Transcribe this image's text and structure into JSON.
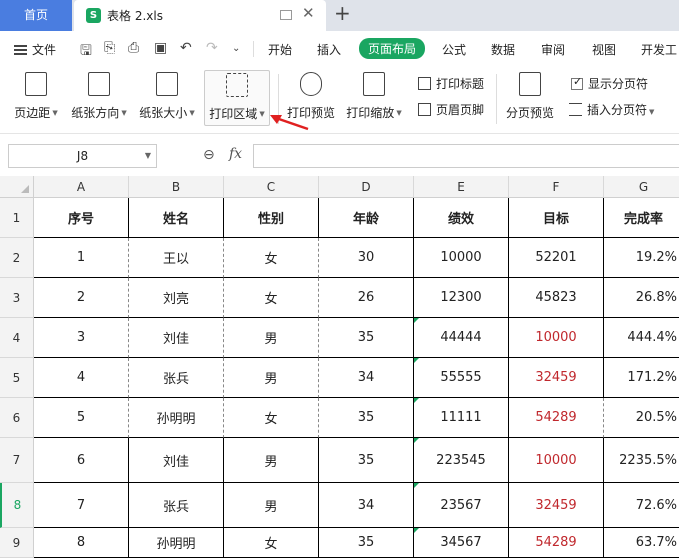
{
  "tabs": {
    "home": "首页",
    "file_icon": "S",
    "file_name": "表格 2.xls",
    "add": "+"
  },
  "menu": {
    "file_label": "文件",
    "tabs": [
      "开始",
      "插入",
      "页面布局",
      "公式",
      "数据",
      "审阅",
      "视图",
      "开发工"
    ],
    "active_index": 2
  },
  "ribbon": {
    "buttons": [
      {
        "label": "页边距",
        "icon": "margins-icon",
        "dropdown": true
      },
      {
        "label": "纸张方向",
        "icon": "orientation-icon",
        "dropdown": true
      },
      {
        "label": "纸张大小",
        "icon": "paper-size-icon",
        "dropdown": true
      },
      {
        "label": "打印区域",
        "icon": "print-area-icon",
        "dropdown": true
      },
      {
        "label": "打印预览",
        "icon": "print-preview-icon",
        "dropdown": false
      },
      {
        "label": "打印缩放",
        "icon": "print-scale-icon",
        "dropdown": true
      },
      {
        "label": "分页预览",
        "icon": "page-break-preview-icon",
        "dropdown": false
      }
    ],
    "print_titles": "打印标题",
    "header_footer": "页眉页脚",
    "show_page_breaks": "显示分页符",
    "insert_page_break": "插入分页符"
  },
  "formula_bar": {
    "cell_ref": "J8",
    "fx": "fx",
    "value": ""
  },
  "grid": {
    "columns": [
      "A",
      "B",
      "C",
      "D",
      "E",
      "F",
      "G"
    ],
    "row_numbers": [
      "1",
      "2",
      "3",
      "4",
      "5",
      "6",
      "7",
      "8",
      "9"
    ],
    "current_row": "8",
    "header": [
      "序号",
      "姓名",
      "性别",
      "年龄",
      "绩效",
      "目标",
      "完成率"
    ],
    "rows": [
      [
        "1",
        "王以",
        "女",
        "30",
        "10000",
        "52201",
        "19.2%"
      ],
      [
        "2",
        "刘亮",
        "女",
        "26",
        "12300",
        "45823",
        "26.8%"
      ],
      [
        "3",
        "刘佳",
        "男",
        "35",
        "44444",
        "10000",
        "444.4%"
      ],
      [
        "4",
        "张兵",
        "男",
        "34",
        "55555",
        "32459",
        "171.2%"
      ],
      [
        "5",
        "孙明明",
        "女",
        "35",
        "11111",
        "54289",
        "20.5%"
      ],
      [
        "6",
        "刘佳",
        "男",
        "35",
        "223545",
        "10000",
        "2235.5%"
      ],
      [
        "7",
        "张兵",
        "男",
        "34",
        "23567",
        "32459",
        "72.6%"
      ],
      [
        "8",
        "孙明明",
        "女",
        "35",
        "34567",
        "54289",
        "63.7%"
      ]
    ],
    "red_target_rows": [
      2,
      3,
      4,
      5,
      6,
      7
    ]
  },
  "colors": {
    "accent": "#1aa661",
    "home_tab": "#4a7de0",
    "alert_red": "#c0282d",
    "arrow": "#e02020"
  }
}
